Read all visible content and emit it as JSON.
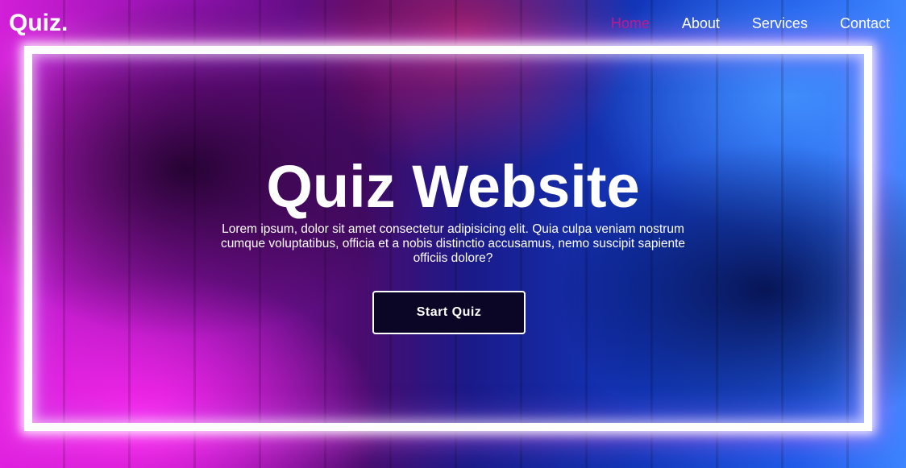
{
  "header": {
    "logo": "Quiz.",
    "nav": {
      "home": "Home",
      "about": "About",
      "services": "Services",
      "contact": "Contact"
    },
    "active_color": "#c2188f"
  },
  "hero": {
    "title": "Quiz Website",
    "description": "Lorem ipsum, dolor sit amet consectetur adipisicing elit. Quia culpa veniam nostrum cumque voluptatibus, officia et a nobis distinctio accusamus, nemo suscipit sapiente officiis dolore?",
    "button_label": "Start Quiz"
  },
  "colors": {
    "left_glow": "#d21fd8",
    "right_glow": "#1f5ae8",
    "button_bg": "#0c0626"
  }
}
